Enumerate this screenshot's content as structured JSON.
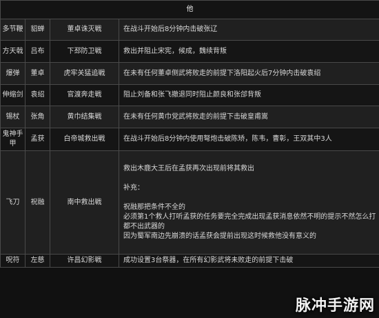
{
  "table": {
    "header": "他",
    "rows": [
      {
        "weapon": "多节鞭",
        "person": "貂蝉",
        "battle": "董卓诛灭戦",
        "requirement": [
          "在战斗开始后8分钟内击破张辽"
        ]
      },
      {
        "weapon": "方天戟",
        "person": "吕布",
        "battle": "下邳防卫戦",
        "requirement": [
          "救出并阻止宋宪，候成，魏续背叛"
        ]
      },
      {
        "weapon": "爆弹",
        "person": "董卓",
        "battle": "虎牢关猛追戦",
        "requirement": [
          "在未有任何董卓侧武将败走的前提下洛阳起火后7分钟内击破袁绍"
        ]
      },
      {
        "weapon": "伸缩剑",
        "person": "袁绍",
        "battle": "官渡奔走戦",
        "requirement": [
          "阻止刘备和张飞撤退同时阻止颜良和张郃背叛"
        ]
      },
      {
        "weapon": "锡杖",
        "person": "张角",
        "battle": "黄巾结集戦",
        "requirement": [
          "在未有任何黄巾党武将败走的前提下击破皇甫嵩"
        ]
      },
      {
        "weapon": "鬼神手甲",
        "person": "孟获",
        "battle": "白帝城救出戦",
        "requirement": [
          "在战斗开始后8分钟内使用弩炮击破陈矫，陈韦，曹彰，王双其中3人"
        ]
      },
      {
        "weapon": "飞刀",
        "person": "祝融",
        "battle": "南中救出戦",
        "requirement": [
          "救出木鹿大王后在孟获再次出现前将其救出",
          "",
          "补充：",
          "",
          "祝融那把条件不全的",
          "必须第1个救人打听孟获的任务要完全完成出现孟获消息依然不明的提示不然怎么打都不出武器的",
          "因为蜀军南边先崩溃的话孟获会提前出现这时候救他没有意义的"
        ]
      },
      {
        "weapon": "呪符",
        "person": "左慈",
        "battle": "许昌幻影戦",
        "requirement": [
          "成功设置3台祭器，在所有幻影武将未败走的前提下击破"
        ]
      }
    ]
  },
  "watermark": "脉冲手游网"
}
